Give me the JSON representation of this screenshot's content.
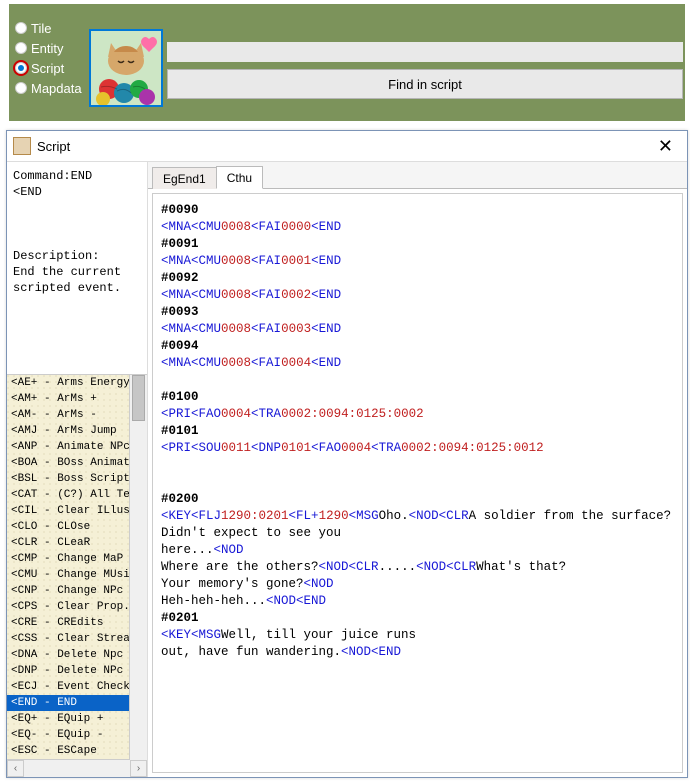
{
  "top": {
    "radios": [
      "Tile",
      "Entity",
      "Script",
      "Mapdata"
    ],
    "selected": 2,
    "find_label": "Find in script"
  },
  "window": {
    "title": "Script",
    "info_text": "Command:END\n<END\n\n\n\nDescription:\nEnd the current scripted event.",
    "cmd_list": [
      "<AE+ - Arms Energy +",
      "<AM+ - ArMs +",
      "<AM- - ArMs -",
      "<AMJ - ArMs Jump",
      "<ANP - Animate NPc",
      "<BOA - BOss Animation",
      "<BSL - Boss Script Load",
      "<CAT - (C?) All Text",
      "<CIL - Clear ILlustration",
      "<CLO - CLOse",
      "<CLR - CLeaR",
      "<CMP - Change MaP",
      "<CMU - Change MUsic",
      "<CNP - Change NPc",
      "<CPS - Clear Prop. Sound",
      "<CRE - CREdits",
      "<CSS - Clear Stream Sound",
      "<DNA - Delete Npc (All)",
      "<DNP - Delete NPc",
      "<ECJ - Event Check Jump",
      "<END - END",
      "<EQ+ - EQuip +",
      "<EQ- - EQuip -",
      "<ESC - ESCape"
    ],
    "cmd_selected_index": 20,
    "tabs": [
      "EgEnd1",
      "Cthu"
    ],
    "active_tab": 1,
    "script_lines": [
      {
        "t": "evt",
        "v": "#0090"
      },
      {
        "t": "seq",
        "parts": [
          [
            "cmd",
            "<MNA"
          ],
          [
            "cmd",
            "<CMU"
          ],
          [
            "num",
            "0008"
          ],
          [
            "cmd",
            "<FAI"
          ],
          [
            "num",
            "0000"
          ],
          [
            "cmd",
            "<END"
          ]
        ]
      },
      {
        "t": "evt",
        "v": "#0091"
      },
      {
        "t": "seq",
        "parts": [
          [
            "cmd",
            "<MNA"
          ],
          [
            "cmd",
            "<CMU"
          ],
          [
            "num",
            "0008"
          ],
          [
            "cmd",
            "<FAI"
          ],
          [
            "num",
            "0001"
          ],
          [
            "cmd",
            "<END"
          ]
        ]
      },
      {
        "t": "evt",
        "v": "#0092"
      },
      {
        "t": "seq",
        "parts": [
          [
            "cmd",
            "<MNA"
          ],
          [
            "cmd",
            "<CMU"
          ],
          [
            "num",
            "0008"
          ],
          [
            "cmd",
            "<FAI"
          ],
          [
            "num",
            "0002"
          ],
          [
            "cmd",
            "<END"
          ]
        ]
      },
      {
        "t": "evt",
        "v": "#0093"
      },
      {
        "t": "seq",
        "parts": [
          [
            "cmd",
            "<MNA"
          ],
          [
            "cmd",
            "<CMU"
          ],
          [
            "num",
            "0008"
          ],
          [
            "cmd",
            "<FAI"
          ],
          [
            "num",
            "0003"
          ],
          [
            "cmd",
            "<END"
          ]
        ]
      },
      {
        "t": "evt",
        "v": "#0094"
      },
      {
        "t": "seq",
        "parts": [
          [
            "cmd",
            "<MNA"
          ],
          [
            "cmd",
            "<CMU"
          ],
          [
            "num",
            "0008"
          ],
          [
            "cmd",
            "<FAI"
          ],
          [
            "num",
            "0004"
          ],
          [
            "cmd",
            "<END"
          ]
        ]
      },
      {
        "t": "blank",
        "v": ""
      },
      {
        "t": "evt",
        "v": "#0100"
      },
      {
        "t": "seq",
        "parts": [
          [
            "cmd",
            "<PRI"
          ],
          [
            "cmd",
            "<FAO"
          ],
          [
            "num",
            "0004"
          ],
          [
            "cmd",
            "<TRA"
          ],
          [
            "num",
            "0002:0094:0125:0002"
          ]
        ]
      },
      {
        "t": "evt",
        "v": "#0101"
      },
      {
        "t": "seq",
        "parts": [
          [
            "cmd",
            "<PRI"
          ],
          [
            "cmd",
            "<SOU"
          ],
          [
            "num",
            "0011"
          ],
          [
            "cmd",
            "<DNP"
          ],
          [
            "num",
            "0101"
          ],
          [
            "cmd",
            "<FAO"
          ],
          [
            "num",
            "0004"
          ],
          [
            "cmd",
            "<TRA"
          ],
          [
            "num",
            "0002:0094:0125:0012"
          ]
        ]
      },
      {
        "t": "blank",
        "v": ""
      },
      {
        "t": "blank",
        "v": ""
      },
      {
        "t": "evt",
        "v": "#0200"
      },
      {
        "t": "seq",
        "parts": [
          [
            "cmd",
            "<KEY"
          ],
          [
            "cmd",
            "<FLJ"
          ],
          [
            "num",
            "1290:0201"
          ],
          [
            "cmd",
            "<FL+"
          ],
          [
            "num",
            "1290"
          ],
          [
            "cmd",
            "<MSG"
          ],
          [
            "txt",
            "Oho."
          ],
          [
            "cmd",
            "<NOD"
          ],
          [
            "cmd",
            "<CLR"
          ],
          [
            "txt",
            "A soldier from the surface?"
          ]
        ]
      },
      {
        "t": "txt",
        "v": "Didn't expect to see you"
      },
      {
        "t": "seq",
        "parts": [
          [
            "txt",
            "here..."
          ],
          [
            "cmd",
            "<NOD"
          ]
        ]
      },
      {
        "t": "seq",
        "parts": [
          [
            "txt",
            "Where are the others?"
          ],
          [
            "cmd",
            "<NOD"
          ],
          [
            "cmd",
            "<CLR"
          ],
          [
            "txt",
            "....."
          ],
          [
            "cmd",
            "<NOD"
          ],
          [
            "cmd",
            "<CLR"
          ],
          [
            "txt",
            "What's that?"
          ]
        ]
      },
      {
        "t": "seq",
        "parts": [
          [
            "txt",
            "Your memory's gone?"
          ],
          [
            "cmd",
            "<NOD"
          ]
        ]
      },
      {
        "t": "seq",
        "parts": [
          [
            "txt",
            "Heh-heh-heh..."
          ],
          [
            "cmd",
            "<NOD"
          ],
          [
            "cmd",
            "<END"
          ]
        ]
      },
      {
        "t": "evt",
        "v": "#0201"
      },
      {
        "t": "seq",
        "parts": [
          [
            "cmd",
            "<KEY"
          ],
          [
            "cmd",
            "<MSG"
          ],
          [
            "txt",
            "Well, till your juice runs"
          ]
        ]
      },
      {
        "t": "seq",
        "parts": [
          [
            "txt",
            "out, have fun wandering."
          ],
          [
            "cmd",
            "<NOD"
          ],
          [
            "cmd",
            "<END"
          ]
        ]
      }
    ]
  }
}
